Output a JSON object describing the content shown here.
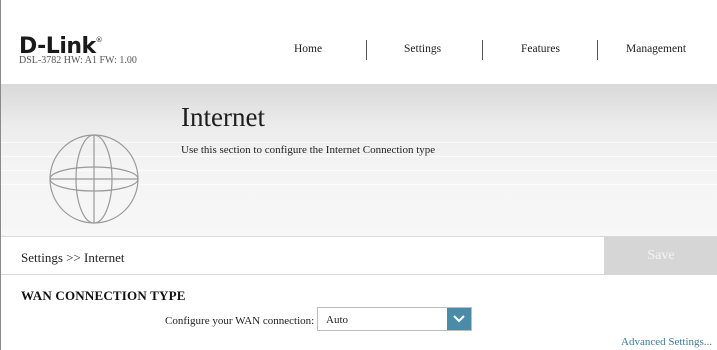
{
  "header": {
    "logo": "D-Link",
    "model_info": "DSL-3782  HW: A1  FW: 1.00",
    "nav": [
      "Home",
      "Settings",
      "Features",
      "Management"
    ]
  },
  "hero": {
    "title": "Internet",
    "description": "Use this section to configure the Internet Connection type",
    "icon": "globe-icon"
  },
  "breadcrumb": "Settings >> Internet",
  "save_label": "Save",
  "section": {
    "title": "WAN CONNECTION TYPE",
    "field_label": "Configure your WAN connection:",
    "select_value": "Auto",
    "advanced_link": "Advanced Settings..."
  },
  "colors": {
    "accent": "#4a8ba8",
    "link": "#3c7d9b",
    "save_disabled": "#d6d6d6"
  }
}
